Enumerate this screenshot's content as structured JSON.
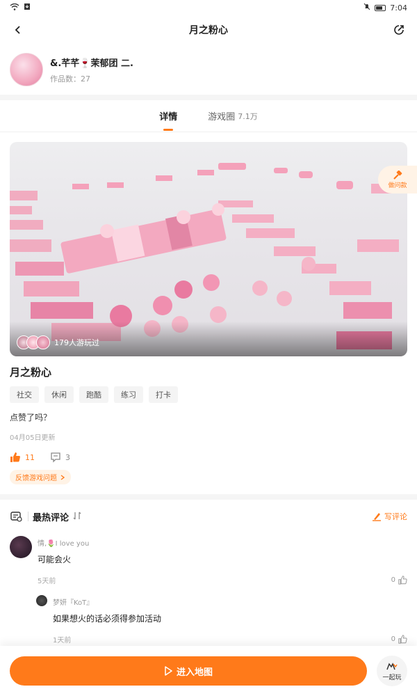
{
  "status": {
    "time": "7:04"
  },
  "header": {
    "title": "月之粉心"
  },
  "author": {
    "name": "&.芊芊🍷茉郁团 二.",
    "works_label": "作品数：27"
  },
  "tabs": [
    {
      "label": "详情",
      "active": true
    },
    {
      "label": "游戏圈",
      "count": "7.1万"
    }
  ],
  "cover": {
    "players_text": "179人游玩过",
    "help_label": "做问款"
  },
  "game": {
    "title": "月之粉心",
    "tags": [
      "社交",
      "休闲",
      "跑酷",
      "练习",
      "打卡"
    ],
    "description": "点赞了吗？",
    "update": "04月05日更新",
    "likes": "11",
    "comments": "3",
    "feedback": "反馈游戏问题"
  },
  "comments_section": {
    "title": "最热评论",
    "write": "写评论",
    "items": [
      {
        "user": "情,🌷I love you",
        "text": "可能会火",
        "time": "5天前",
        "likes": "0"
      }
    ],
    "replies": [
      {
        "user": "梦妍『KoT』",
        "text": "如果想火的话必须得参加活动",
        "time": "1天前",
        "likes": "0"
      }
    ]
  },
  "bottom": {
    "enter_label": "进入地图",
    "together_label": "一起玩"
  },
  "colors": {
    "accent": "#ff7a1a"
  }
}
